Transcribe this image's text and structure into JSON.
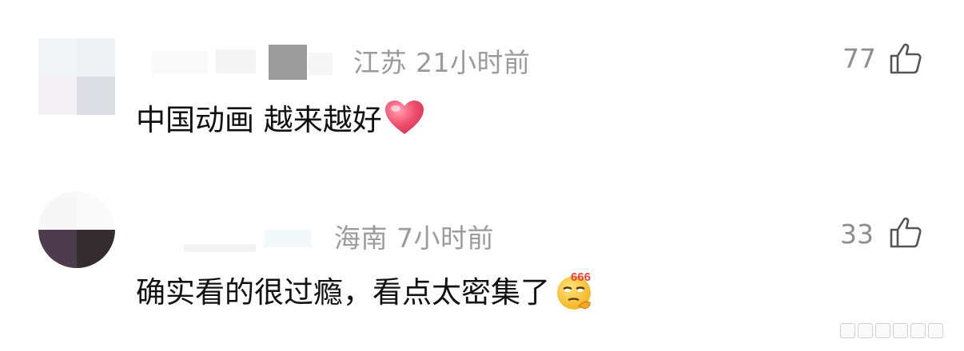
{
  "comments": [
    {
      "location": "江苏",
      "time": "21小时前",
      "text": "中国动画 越来越好",
      "emoji": "heart-icon",
      "likes": "77"
    },
    {
      "location": "海南",
      "time": "7小时前",
      "text": "确实看的很过瘾，看点太密集了",
      "emoji": "smug-666-emoji-icon",
      "likes": "33"
    }
  ],
  "icons": {
    "like": "thumbs-up-icon"
  },
  "colors": {
    "meta": "#9b9b9b",
    "text": "#111111",
    "heart": "#f0516f"
  }
}
